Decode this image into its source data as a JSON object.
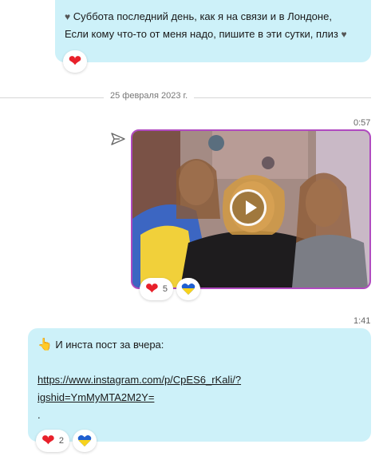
{
  "messages": {
    "top": {
      "line1": "Суббота последний день, как я на связи и в Лондоне,",
      "line2": "Если кому что-то от меня надо, пишите в эти сутки, плиз",
      "reaction_heart": "❤"
    },
    "date_separator": "25 февраля 2023 г.",
    "video": {
      "time": "0:57",
      "reactions": [
        {
          "icon": "❤",
          "count": "5"
        },
        {
          "icon": "ukraine-heart-icon",
          "count": ""
        }
      ]
    },
    "bottom": {
      "time": "1:41",
      "text": "И инста пост за вчера:",
      "link_line1": "https://www.instagram.com/p/CpES6_rKali/?",
      "link_line2": "igshid=YmMyMTA2M2Y=",
      "dot": ".",
      "reactions": [
        {
          "icon": "❤",
          "count": "2"
        },
        {
          "icon": "ukraine-heart-icon",
          "count": ""
        }
      ]
    }
  },
  "colors": {
    "bubble": "#cdf1f9",
    "heart": "#e8202a",
    "media_border": "#b04ac0",
    "ukraine_blue": "#1f5fd0",
    "ukraine_yellow": "#f7d21c"
  }
}
